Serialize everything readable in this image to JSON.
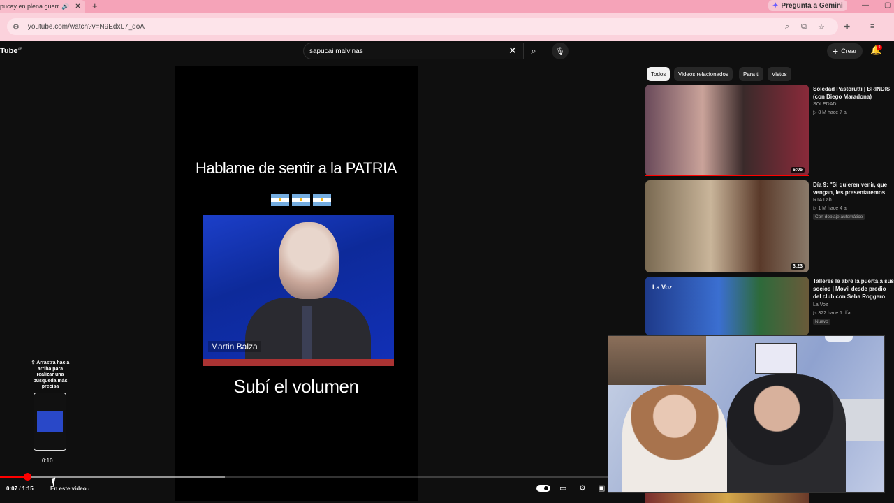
{
  "browser": {
    "tab_title": "pucay en plena guerr...",
    "speaker_icon": "speaker-icon",
    "close_tab": "✕",
    "new_tab": "+",
    "gemini_label": "Pregunta a Gemini",
    "url": "youtube.com/watch?v=N9EdxL7_doA"
  },
  "header": {
    "logo": "Tube",
    "logo_sup": "AR",
    "search_value": "sapucai malvinas",
    "create_label": "Crear",
    "notif_count": "9"
  },
  "video": {
    "caption_top": "Hablame de sentir a la PATRIA",
    "name_tag": "Martin Balza",
    "caption_bottom": "Subí el volumen",
    "current_time": "0:07 / 1:15",
    "chapter_label": "En este video",
    "progress_fraction": 0.045,
    "buffer_fraction": 0.37
  },
  "hint": {
    "text": "⇧ Arrastra hacia arriba para realizar una búsqueda más precisa",
    "preview_time": "0:10"
  },
  "chips": [
    "Todos",
    "Videos relacionados",
    "Para ti",
    "Vistos"
  ],
  "related": [
    {
      "title": "Soledad Pastorutti | BRINDIS (con Diego Maradona)",
      "channel": "SOLEDAD",
      "meta": "▷ 8 M  hace 7 a",
      "duration": "6:05"
    },
    {
      "title": "Día 9: \"Si quieren venir, que vengan, les presentaremos batalla\"",
      "channel": "RTA Lab",
      "meta": "▷ 1 M  hace 4 a",
      "badge": "Con doblaje automático",
      "duration": "3:23"
    },
    {
      "title": "Talleres le abre la puerta a sus socios | Movil desde predio del club con Seba Roggero",
      "channel": "La Voz",
      "meta": "▷ 322  hace 1 día",
      "badge": "Nuevo",
      "thumb_text": "La Voz"
    }
  ],
  "colors": {
    "accent": "#ff0000",
    "tab_bar": "#f5a3b8",
    "background": "#0f0f0f"
  }
}
